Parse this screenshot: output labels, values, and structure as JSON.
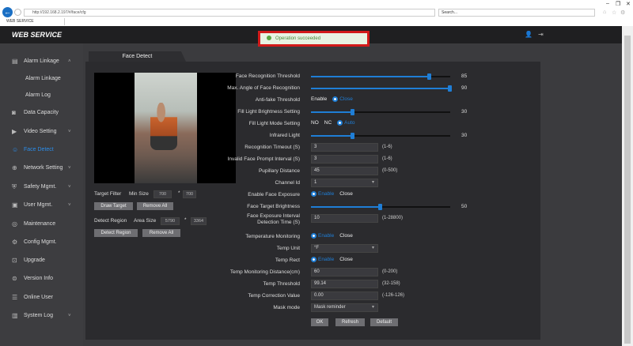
{
  "browser": {
    "url": "http://192.168.2.197/#/face/cfg",
    "search_placeholder": "Search...",
    "tab_title": "WEB SERVICE"
  },
  "header": {
    "logo": "WEB SERVICE"
  },
  "toast": {
    "message": "Operation succeeded"
  },
  "sidebar": {
    "items": [
      {
        "label": "Alarm Linkage",
        "icon": "alarm-icon"
      },
      {
        "label": "Alarm Linkage"
      },
      {
        "label": "Alarm Log"
      },
      {
        "label": "Data Capacity",
        "icon": "database-icon"
      },
      {
        "label": "Video Setting",
        "icon": "video-icon"
      },
      {
        "label": "Face Detect",
        "icon": "face-icon"
      },
      {
        "label": "Network Setting",
        "icon": "network-icon"
      },
      {
        "label": "Safety Mgmt.",
        "icon": "shield-icon"
      },
      {
        "label": "User Mgmt.",
        "icon": "user-icon"
      },
      {
        "label": "Maintenance",
        "icon": "wrench-icon"
      },
      {
        "label": "Config Mgmt.",
        "icon": "config-icon"
      },
      {
        "label": "Upgrade",
        "icon": "upgrade-icon"
      },
      {
        "label": "Version Info",
        "icon": "info-icon"
      },
      {
        "label": "Online User",
        "icon": "online-user-icon"
      },
      {
        "label": "System Log",
        "icon": "log-icon"
      }
    ]
  },
  "page_tab": "Face Detect",
  "target": {
    "filter_label": "Target Filter",
    "min_size_label": "Min Size",
    "min_w": "700",
    "min_h": "700",
    "sep": "*",
    "draw_btn": "Draw Target",
    "remove_btn": "Remove All"
  },
  "region": {
    "label": "Detect Region",
    "area_label": "Area Size",
    "area_w": "5790",
    "area_h": "3364",
    "sep": "*",
    "detect_btn": "Detect Region",
    "remove_btn": "Remove All"
  },
  "form": {
    "face_threshold": {
      "label": "Face Recognition Threshold",
      "value": "85",
      "fraction": 0.85
    },
    "max_angle": {
      "label": "Max. Angle of Face Recognition",
      "value": "90",
      "fraction": 1.0
    },
    "antifake": {
      "label": "Anti-fake Threshold",
      "opt1": "Enable",
      "opt2": "Close"
    },
    "fill_brightness": {
      "label": "Fill Light Brightness Setting",
      "value": "30",
      "fraction": 0.3
    },
    "fill_mode": {
      "label": "Fill Light Mode Setting",
      "opt1": "NO",
      "opt2": "NC",
      "opt3": "Auto"
    },
    "infrared": {
      "label": "Infrared Light",
      "value": "30",
      "fraction": 0.3
    },
    "recog_timeout": {
      "label": "Recognition Timeout (S)",
      "value": "3",
      "range": "(1-6)"
    },
    "invalid_prompt": {
      "label": "Invalid Face Prompt Interval (S)",
      "value": "3",
      "range": "(1-6)"
    },
    "pupillary": {
      "label": "Pupillary Distance",
      "value": "45",
      "range": "(0-500)"
    },
    "channel": {
      "label": "Channel Id",
      "value": "1"
    },
    "face_exposure": {
      "label": "Enable Face Exposure",
      "opt1": "Enable",
      "opt2": "Close"
    },
    "target_brightness": {
      "label": "Face Target Brightness",
      "value": "50",
      "fraction": 0.5
    },
    "exposure_interval": {
      "label1": "Face Exposure Interval",
      "label2": "Detection Time (S)",
      "value": "10",
      "range": "(1-28800)"
    },
    "temp_monitor": {
      "label": "Temperature Monitoring",
      "opt1": "Enable",
      "opt2": "Close"
    },
    "temp_unit": {
      "label": "Temp Unit",
      "value": "°F"
    },
    "temp_rect": {
      "label": "Temp Rect",
      "opt1": "Enable",
      "opt2": "Close"
    },
    "temp_distance": {
      "label": "Temp Monitoring Distance(cm)",
      "value": "60",
      "range": "(0-200)"
    },
    "temp_threshold": {
      "label": "Temp Threshold",
      "value": "99.14",
      "range": "(32-158)"
    },
    "temp_correction": {
      "label": "Temp Correction Value",
      "value": "0.00",
      "range": "(-126-126)"
    },
    "mask_mode": {
      "label": "Mask mode",
      "value": "Mask reminder"
    }
  },
  "buttons": {
    "ok": "OK",
    "refresh": "Refresh",
    "default": "Default"
  },
  "colors": {
    "accent": "#1f7ed6",
    "toast_border": "#d21a1a"
  }
}
